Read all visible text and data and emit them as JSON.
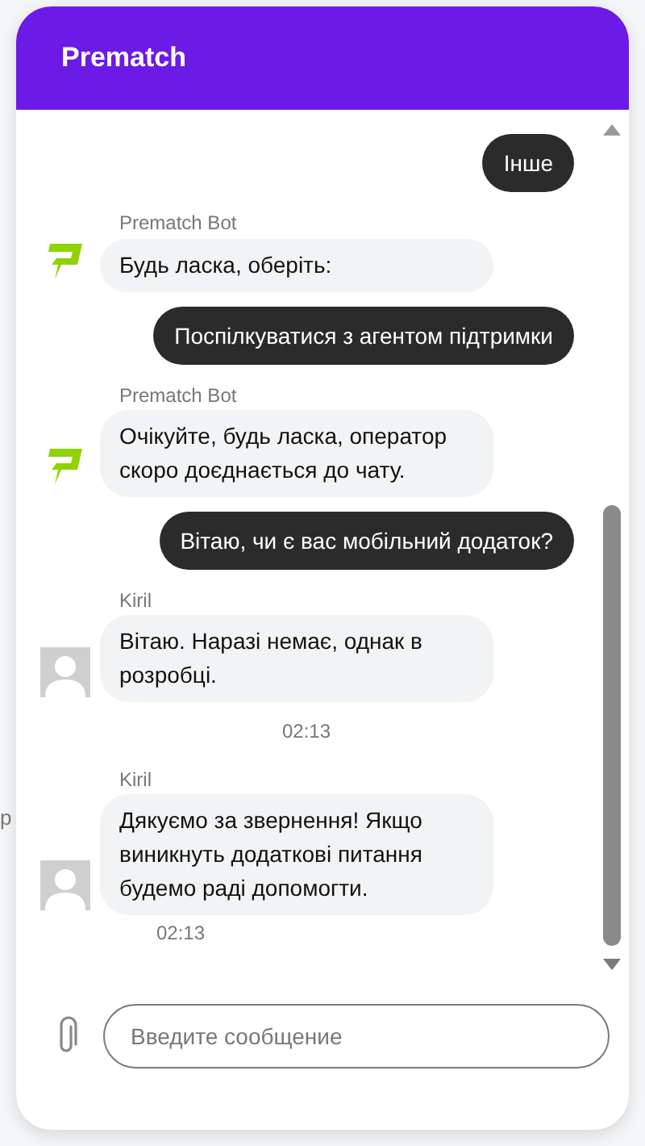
{
  "page_behind": {
    "text": "р"
  },
  "header": {
    "title": "Prematch"
  },
  "messages": [
    {
      "kind": "user",
      "text": "Інше"
    },
    {
      "kind": "incoming",
      "sender": "Prematch Bot",
      "avatar": {
        "kind": "logo"
      },
      "text": "Будь ласка, оберіть:"
    },
    {
      "kind": "user",
      "text": "Поспілкуватися з агентом підтримки"
    },
    {
      "kind": "incoming",
      "sender": "Prematch Bot",
      "avatar": {
        "kind": "logo"
      },
      "text": "Очікуйте, будь ласка, оператор скоро доєднається до чату."
    },
    {
      "kind": "user",
      "text": "Вітаю, чи є вас мобільний додаток?"
    },
    {
      "kind": "incoming",
      "sender": "Kiril",
      "avatar": {
        "kind": "person"
      },
      "text": "Вітаю. Наразі немає, однак в розробці."
    },
    {
      "kind": "time",
      "text": "02:13"
    },
    {
      "kind": "incoming",
      "sender": "Kiril",
      "avatar": {
        "kind": "person"
      },
      "text": "Дякуємо за звернення! Якщо виникнуть додаткові питання будемо раді допомогти.",
      "time": "02:13"
    }
  ],
  "composer": {
    "placeholder": "Введите сообщение"
  }
}
